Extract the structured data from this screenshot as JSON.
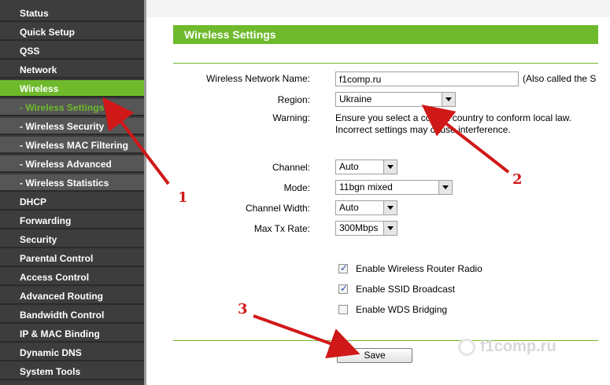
{
  "sidebar": {
    "items": [
      {
        "label": "Status"
      },
      {
        "label": "Quick Setup"
      },
      {
        "label": "QSS"
      },
      {
        "label": "Network"
      },
      {
        "label": "Wireless"
      },
      {
        "label": "- Wireless Settings"
      },
      {
        "label": "- Wireless Security"
      },
      {
        "label": "- Wireless MAC Filtering"
      },
      {
        "label": "- Wireless Advanced"
      },
      {
        "label": "- Wireless Statistics"
      },
      {
        "label": "DHCP"
      },
      {
        "label": "Forwarding"
      },
      {
        "label": "Security"
      },
      {
        "label": "Parental Control"
      },
      {
        "label": "Access Control"
      },
      {
        "label": "Advanced Routing"
      },
      {
        "label": "Bandwidth Control"
      },
      {
        "label": "IP & MAC Binding"
      },
      {
        "label": "Dynamic DNS"
      },
      {
        "label": "System Tools"
      }
    ]
  },
  "main": {
    "title": "Wireless Settings",
    "fields": {
      "network_name_label": "Wireless Network Name:",
      "network_name_value": "f1comp.ru",
      "network_name_note": "(Also called the S",
      "region_label": "Region:",
      "region_value": "Ukraine",
      "warning_label": "Warning:",
      "warning_line1": "Ensure you select a correct country to conform local law.",
      "warning_line2": "Incorrect settings may cause interference.",
      "channel_label": "Channel:",
      "channel_value": "Auto",
      "mode_label": "Mode:",
      "mode_value": "11bgn mixed",
      "channel_width_label": "Channel Width:",
      "channel_width_value": "Auto",
      "max_tx_label": "Max Tx Rate:",
      "max_tx_value": "300Mbps"
    },
    "checkboxes": {
      "radio_label": "Enable Wireless Router Radio",
      "radio_checked": true,
      "ssid_label": "Enable SSID Broadcast",
      "ssid_checked": true,
      "wds_label": "Enable WDS Bridging",
      "wds_checked": false
    },
    "save_label": "Save"
  },
  "annotations": {
    "num1": "1",
    "num2": "2",
    "num3": "3"
  },
  "watermark": "f1comp.ru",
  "colors": {
    "accent": "#6fba2c",
    "sidebar": "#3d3d3d",
    "arrow": "#d01818"
  }
}
